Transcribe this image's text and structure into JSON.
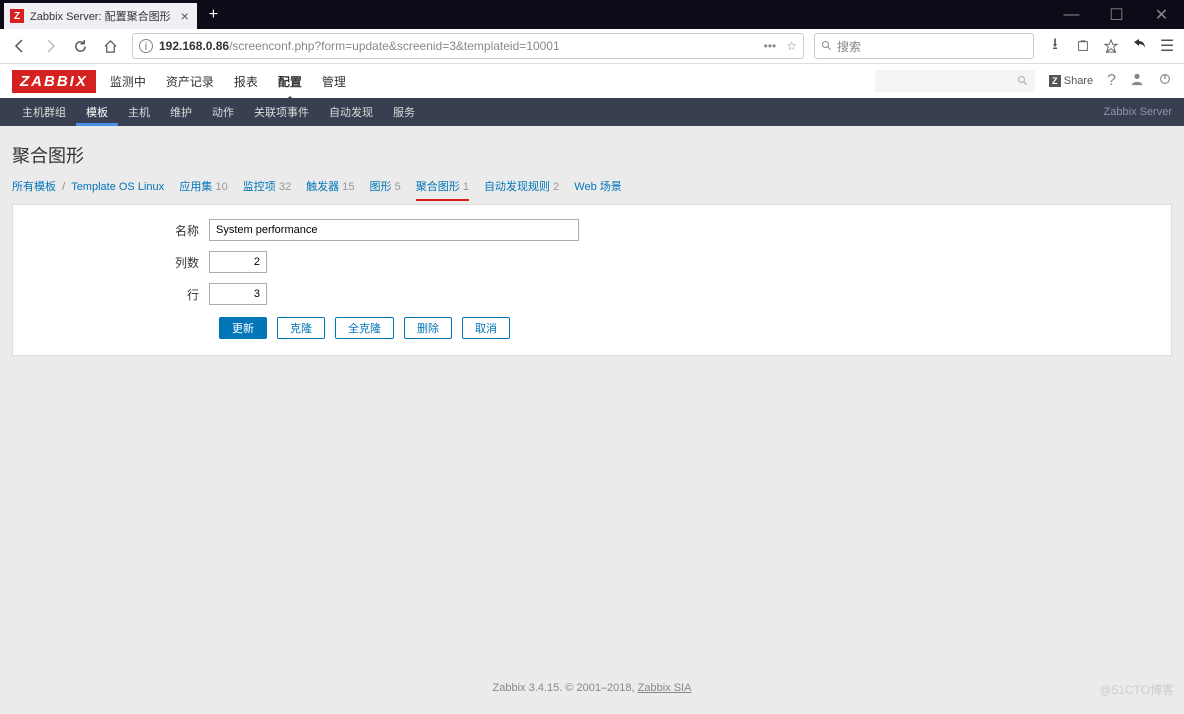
{
  "browser": {
    "tab_title": "Zabbix Server: 配置聚合图形",
    "url_host": "192.168.0.86",
    "url_path": "/screenconf.php?form=update&screenid=3&templateid=10001",
    "search_placeholder": "搜索"
  },
  "zabbix": {
    "logo": "ZABBIX",
    "menu": [
      "监测中",
      "资产记录",
      "报表",
      "配置",
      "管理"
    ],
    "active_menu_index": 3,
    "share": "Share",
    "subnav": [
      "主机群组",
      "模板",
      "主机",
      "维护",
      "动作",
      "关联项事件",
      "自动发现",
      "服务"
    ],
    "active_subnav_index": 1,
    "subnav_right": "Zabbix Server"
  },
  "page": {
    "title": "聚合图形",
    "breadcrumb": {
      "all_templates": "所有模板",
      "template_name": "Template OS Linux"
    },
    "tabs": [
      {
        "label": "应用集",
        "count": "10"
      },
      {
        "label": "监控项",
        "count": "32"
      },
      {
        "label": "触发器",
        "count": "15"
      },
      {
        "label": "图形",
        "count": "5"
      },
      {
        "label": "聚合图形",
        "count": "1",
        "active": true
      },
      {
        "label": "自动发现规则",
        "count": "2"
      },
      {
        "label": "Web 场景",
        "count": ""
      }
    ],
    "form": {
      "name_label": "名称",
      "name_value": "System performance",
      "cols_label": "列数",
      "cols_value": "2",
      "rows_label": "行",
      "rows_value": "3"
    },
    "buttons": {
      "update": "更新",
      "clone": "克隆",
      "full_clone": "全克隆",
      "delete": "删除",
      "cancel": "取消"
    }
  },
  "footer": {
    "text": "Zabbix 3.4.15. © 2001–2018, ",
    "link": "Zabbix SIA"
  },
  "watermark": "@51CTO博客"
}
